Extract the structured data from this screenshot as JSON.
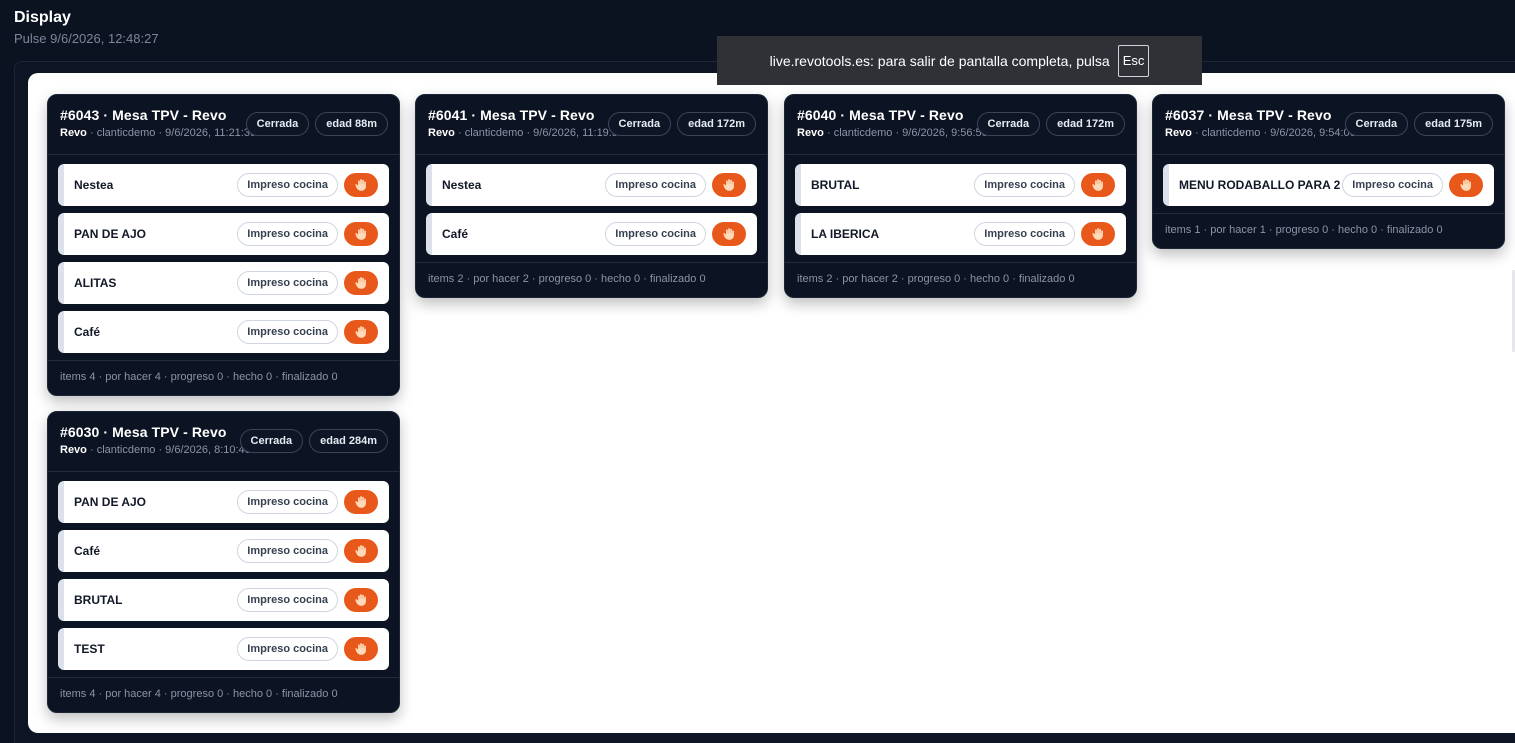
{
  "app": {
    "title": "Display",
    "subtitle": "Pulse 9/6/2026, 12:48:27"
  },
  "fullscreen_notice": {
    "text": "live.revotools.es: para salir de pantalla completa, pulsa",
    "key": "Esc"
  },
  "colors": {
    "background": "#0b1220",
    "card": "#0c1322",
    "accent": "#e8581a"
  },
  "cards": [
    {
      "title": "#6043 · Mesa TPV - Revo",
      "source": "Revo",
      "meta": "· clanticdemo · 9/6/2026, 11:21:39",
      "status": "Cerrada",
      "age": "edad 88m",
      "items": [
        {
          "name": "Nestea",
          "status": "Impreso cocina",
          "icon": "hand-icon"
        },
        {
          "name": "PAN DE AJO",
          "status": "Impreso cocina",
          "icon": "hand-icon"
        },
        {
          "name": "ALITAS",
          "status": "Impreso cocina",
          "icon": "hand-icon"
        },
        {
          "name": "Café",
          "status": "Impreso cocina",
          "icon": "hand-icon"
        }
      ],
      "footer": "items 4 · por hacer 4 · progreso 0 · hecho 0 · finalizado 0"
    },
    {
      "title": "#6041 · Mesa TPV - Revo",
      "source": "Revo",
      "meta": "· clanticdemo · 9/6/2026, 11:19:56",
      "status": "Cerrada",
      "age": "edad 172m",
      "items": [
        {
          "name": "Nestea",
          "status": "Impreso cocina",
          "icon": "hand-icon"
        },
        {
          "name": "Café",
          "status": "Impreso cocina",
          "icon": "hand-icon"
        }
      ],
      "footer": "items 2 · por hacer 2 · progreso 0 · hecho 0 · finalizado 0"
    },
    {
      "title": "#6040 · Mesa TPV - Revo",
      "source": "Revo",
      "meta": "· clanticdemo · 9/6/2026, 9:56:50",
      "status": "Cerrada",
      "age": "edad 172m",
      "items": [
        {
          "name": "BRUTAL",
          "status": "Impreso cocina",
          "icon": "hand-icon"
        },
        {
          "name": "LA IBERICA",
          "status": "Impreso cocina",
          "icon": "hand-icon"
        }
      ],
      "footer": "items 2 · por hacer 2 · progreso 0 · hecho 0 · finalizado 0"
    },
    {
      "title": "#6037 · Mesa TPV - Revo",
      "source": "Revo",
      "meta": "· clanticdemo · 9/6/2026, 9:54:06",
      "status": "Cerrada",
      "age": "edad 175m",
      "items": [
        {
          "name": "MENU RODABALLO PARA 2",
          "status": "Impreso cocina",
          "icon": "hand-icon"
        }
      ],
      "footer": "items 1 · por hacer 1 · progreso 0 · hecho 0 · finalizado 0"
    },
    {
      "title": "#6030 · Mesa TPV - Revo",
      "source": "Revo",
      "meta": "· clanticdemo · 9/6/2026, 8:10:40",
      "status": "Cerrada",
      "age": "edad 284m",
      "items": [
        {
          "name": "PAN DE AJO",
          "status": "Impreso cocina",
          "icon": "hand-icon"
        },
        {
          "name": "Café",
          "status": "Impreso cocina",
          "icon": "hand-icon"
        },
        {
          "name": "BRUTAL",
          "status": "Impreso cocina",
          "icon": "hand-icon"
        },
        {
          "name": "TEST",
          "status": "Impreso cocina",
          "icon": "hand-icon"
        }
      ],
      "footer": "items 4 · por hacer 4 · progreso 0 · hecho 0 · finalizado 0"
    }
  ]
}
